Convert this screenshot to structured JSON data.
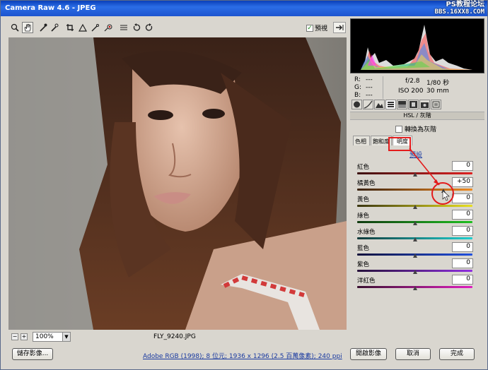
{
  "window": {
    "title": "Camera Raw 4.6  -  JPEG",
    "watermark_top": "PS教程论坛",
    "watermark_bottom": "BBS.16XX8.COM"
  },
  "toolbar": {
    "tools": [
      "zoom-icon",
      "hand-icon",
      "white-balance-icon",
      "color-sampler-icon",
      "crop-icon",
      "straighten-icon",
      "retouch-icon",
      "red-eye-icon",
      "preferences-icon",
      "rotate-left-icon",
      "rotate-right-icon"
    ],
    "preview_label": "預視",
    "preview_checked": true
  },
  "image": {
    "filename": "FLY_9240.JPG"
  },
  "zoom": {
    "value": "100%"
  },
  "readout": {
    "r_label": "R:",
    "g_label": "G:",
    "b_label": "B:",
    "r": "---",
    "g": "---",
    "b": "---",
    "aperture": "f/2.8",
    "shutter": "1/80 秒",
    "iso": "ISO 200",
    "focal": "30 mm"
  },
  "panel": {
    "section_title": "HSL / 灰階",
    "convert_gray_label": "轉換為灰階",
    "subtabs": [
      "色相",
      "飽和度",
      "明度"
    ],
    "default_link": "預設",
    "sliders": [
      {
        "label": "紅色",
        "value": "0",
        "pos": 0.5,
        "gradient": "linear-gradient(90deg,#3a1010,#e02020)"
      },
      {
        "label": "橘黃色",
        "value": "+50",
        "pos": 0.75,
        "gradient": "linear-gradient(90deg,#3a2210,#f08a20)"
      },
      {
        "label": "黃色",
        "value": "0",
        "pos": 0.5,
        "gradient": "linear-gradient(90deg,#3a3510,#e8e020)"
      },
      {
        "label": "綠色",
        "value": "0",
        "pos": 0.5,
        "gradient": "linear-gradient(90deg,#103a10,#20c020)"
      },
      {
        "label": "水綠色",
        "value": "0",
        "pos": 0.5,
        "gradient": "linear-gradient(90deg,#103a3a,#20d0d0)"
      },
      {
        "label": "藍色",
        "value": "0",
        "pos": 0.5,
        "gradient": "linear-gradient(90deg,#10103a,#2050e0)"
      },
      {
        "label": "紫色",
        "value": "0",
        "pos": 0.5,
        "gradient": "linear-gradient(90deg,#25103a,#9030e0)"
      },
      {
        "label": "洋紅色",
        "value": "0",
        "pos": 0.5,
        "gradient": "linear-gradient(90deg,#3a1030,#e020c0)"
      }
    ]
  },
  "footer": {
    "save_label": "儲存影像...",
    "info_link": "Adobe RGB (1998); 8 位元; 1936 x 1296 (2.5 百萬像素); 240 ppi",
    "open_label": "開啟影像",
    "cancel_label": "取消",
    "done_label": "完成"
  },
  "colors": {
    "annotation": "#e31b1b",
    "titlebar": "#1c54cf",
    "link": "#1a3aa0"
  }
}
